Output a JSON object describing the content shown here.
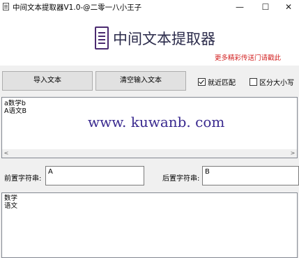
{
  "window": {
    "title": "中间文本提取器V1.0-@二零一八小王子",
    "minimize_glyph": "—",
    "maximize_glyph": "☐",
    "close_glyph": "✕"
  },
  "header": {
    "app_name": "中间文本提取器",
    "promo_link": "更多精彩传送门请戳此",
    "promo_color": "#d21f1f"
  },
  "toolbar": {
    "import_label": "导入文本",
    "clear_label": "清空输入文本",
    "nearest_match_label": "就近匹配",
    "nearest_match_checked": true,
    "case_sensitive_label": "区分大小写",
    "case_sensitive_checked": false
  },
  "input": {
    "lines": [
      "a数学b",
      "A语文B"
    ],
    "watermark": "www. kuwanb. com",
    "scroll_left": "<",
    "scroll_right": ">"
  },
  "fields": {
    "prefix_label": "前置字符串:",
    "prefix_value": "A",
    "suffix_label": "后置字符串:",
    "suffix_value": "B"
  },
  "result": {
    "lines": [
      "数学",
      "语文"
    ]
  }
}
